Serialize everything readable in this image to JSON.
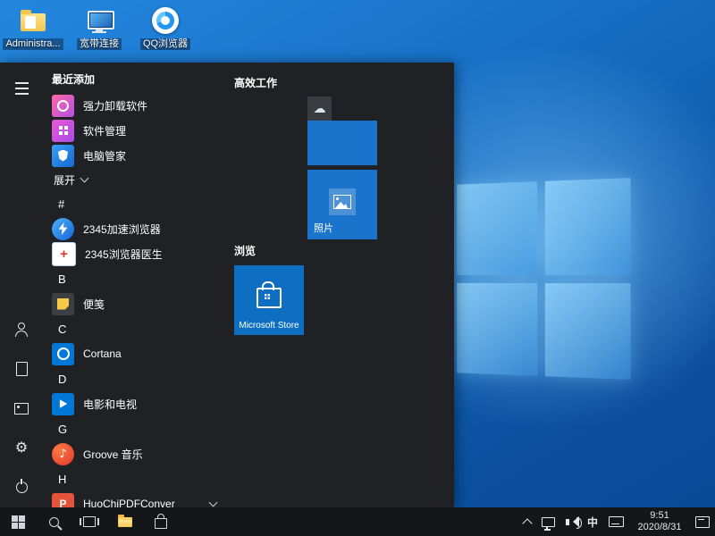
{
  "colors": {
    "accent": "#0078d7",
    "tile_blue": "#1b74cc",
    "store_tile_blue": "#0e6ec2",
    "start_menu_bg": "#1f2124",
    "taskbar_bg": "#14161a",
    "wallpaper_blue": "#1a74cc"
  },
  "desktop": {
    "icons": [
      {
        "label": "Administra..."
      },
      {
        "label": "宽带连接"
      },
      {
        "label": "QQ浏览器"
      }
    ]
  },
  "start": {
    "recent_header": "最近添加",
    "recent_apps": [
      {
        "label": "强力卸载软件"
      },
      {
        "label": "软件管理"
      },
      {
        "label": "电脑管家"
      }
    ],
    "expand_label": "展开",
    "list": [
      {
        "type": "letter",
        "label": "#"
      },
      {
        "type": "app",
        "label": "2345加速浏览器"
      },
      {
        "type": "app",
        "label": "2345浏览器医生"
      },
      {
        "type": "letter",
        "label": "B"
      },
      {
        "type": "app",
        "label": "便笺"
      },
      {
        "type": "letter",
        "label": "C"
      },
      {
        "type": "app",
        "label": "Cortana"
      },
      {
        "type": "letter",
        "label": "D"
      },
      {
        "type": "app",
        "label": "电影和电视"
      },
      {
        "type": "letter",
        "label": "G"
      },
      {
        "type": "app",
        "label": "Groove 音乐"
      },
      {
        "type": "letter",
        "label": "H"
      },
      {
        "type": "app",
        "label": "HuoChiPDFConver"
      }
    ],
    "tiles": {
      "group1_header": "高效工作",
      "group2_header": "浏览",
      "photos_label": "照片",
      "store_label": "Microsoft Store"
    }
  },
  "icons": {
    "cloud_glyph": "☁",
    "note_glyph": "♪",
    "plus_glyph": "+",
    "huochi_letter": "P",
    "gear_glyph": "⚙"
  },
  "taskbar": {
    "ime": "中",
    "clock": {
      "time": "9:51",
      "date": "2020/8/31"
    }
  }
}
